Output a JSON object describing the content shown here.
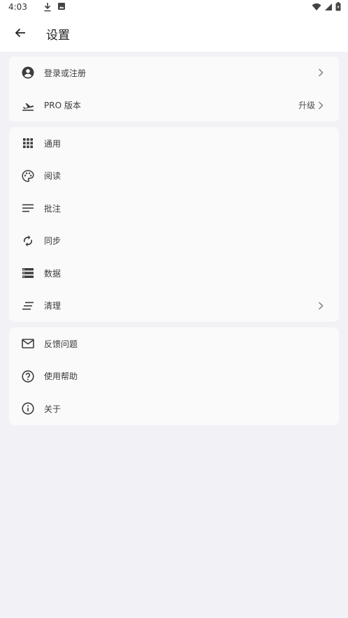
{
  "status_bar": {
    "time": "4:03"
  },
  "app_bar": {
    "title": "设置"
  },
  "account_section": [
    {
      "label": "登录或注册",
      "icon": "account-circle-icon",
      "chevron": true
    },
    {
      "label": "PRO 版本",
      "icon": "flight-takeoff-icon",
      "trailing_text": "升级",
      "chevron": true
    }
  ],
  "settings_section": [
    {
      "label": "通用",
      "icon": "apps-grid-icon"
    },
    {
      "label": "阅读",
      "icon": "palette-icon"
    },
    {
      "label": "批注",
      "icon": "notes-icon"
    },
    {
      "label": "同步",
      "icon": "sync-icon"
    },
    {
      "label": "数据",
      "icon": "storage-icon"
    },
    {
      "label": "清理",
      "icon": "clear-all-icon",
      "chevron": true
    }
  ],
  "help_section": [
    {
      "label": "反馈问题",
      "icon": "mail-icon"
    },
    {
      "label": "使用帮助",
      "icon": "help-circle-icon"
    },
    {
      "label": "关于",
      "icon": "info-icon"
    }
  ],
  "colors": {
    "background": "#f2f1f6",
    "card": "#fafafa",
    "icon": "#3c3c3c"
  }
}
